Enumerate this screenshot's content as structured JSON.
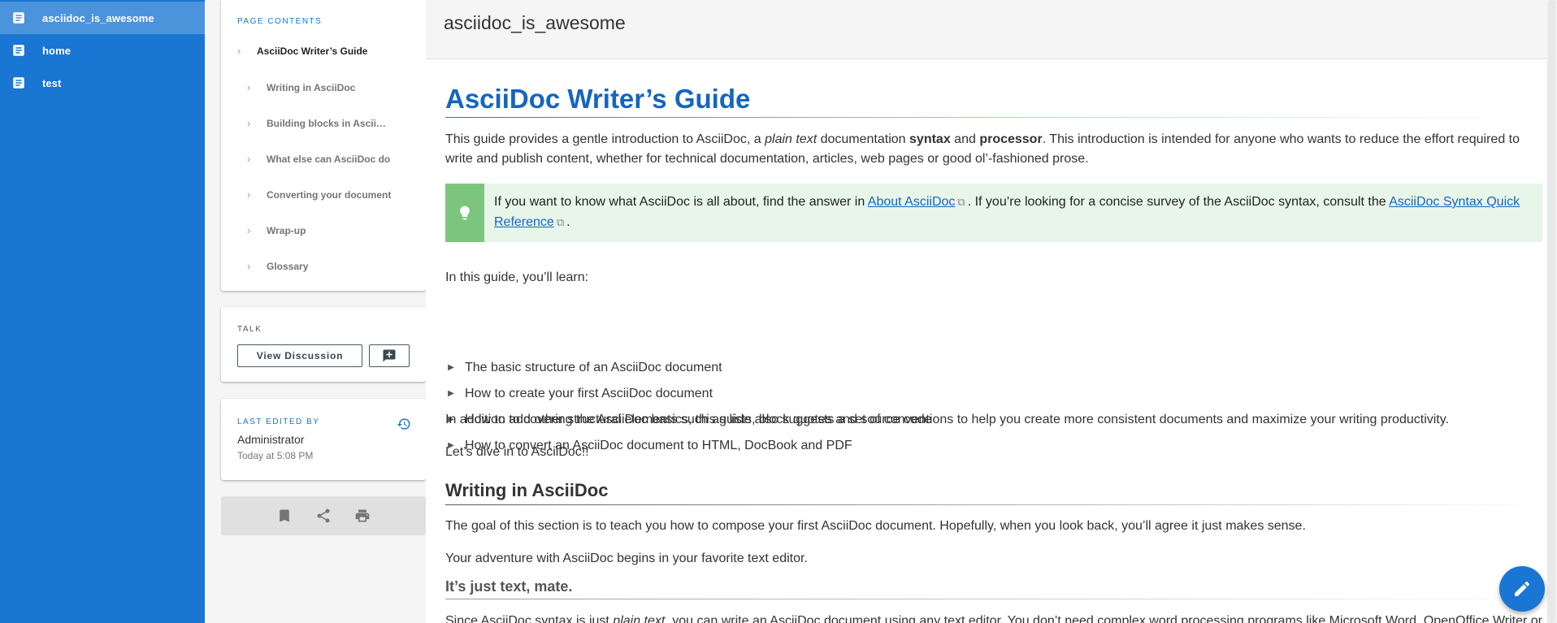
{
  "nav": {
    "items": [
      {
        "label": "asciidoc_is_awesome",
        "active": true
      },
      {
        "label": "home",
        "active": false
      },
      {
        "label": "test",
        "active": false
      }
    ]
  },
  "toc": {
    "caption": "PAGE CONTENTS",
    "title": "AsciiDoc Writer’s Guide",
    "items": [
      "Writing in AsciiDoc",
      "Building blocks in AsciiDoc",
      "What else can AsciiDoc do",
      "Converting your document",
      "Wrap-up",
      "Glossary"
    ]
  },
  "talk": {
    "caption": "TALK",
    "view_label": "View Discussion"
  },
  "edited": {
    "caption": "LAST EDITED BY",
    "who": "Administrator",
    "when": "Today at 5:08 PM"
  },
  "page": {
    "title": "asciidoc_is_awesome"
  },
  "doc": {
    "h1": "AsciiDoc Writer’s Guide",
    "intro_a": "This guide provides a gentle introduction to AsciiDoc, a ",
    "intro_em": "plain text",
    "intro_b": " documentation ",
    "intro_strong1": "syntax",
    "intro_c": " and ",
    "intro_strong2": "processor",
    "intro_d": ". This introduction is intended for anyone who wants to reduce the effort required to write and publish content, whether for technical documentation, articles, web pages or good ol’-fashioned prose.",
    "tip_a": "If you want to know what AsciiDoc is all about, find the answer in ",
    "tip_link1": "About AsciiDoc",
    "tip_b": ". If you’re looking for a concise survey of the AsciiDoc syntax, consult the ",
    "tip_link2": "AsciiDoc Syntax Quick Reference",
    "tip_c": ".",
    "learn": "In this guide, you’ll learn:",
    "bullets": [
      "The basic structure of an AsciiDoc document",
      "How to create your first AsciiDoc document",
      "How to add other structural elements such as lists, block quotes and source code",
      "How to convert an AsciiDoc document to HTML, DocBook and PDF"
    ],
    "addition": "In addition to covering the AsciiDoc basics, this guide also suggests a set of conventions to help you create more consistent documents and maximize your writing productivity.",
    "dive": "Let’s dive in to AsciiDoc!!",
    "h2": "Writing in AsciiDoc",
    "goal": "The goal of this section is to teach you how to compose your first AsciiDoc document. Hopefully, when you look back, you’ll agree it just makes sense.",
    "adventure": "Your adventure with AsciiDoc begins in your favorite text editor.",
    "h3": "It’s just text, mate.",
    "since_a": "Since AsciiDoc syntax is just ",
    "since_em": "plain text",
    "since_b": ", you can write an AsciiDoc document using any text editor. You don’t need complex word processing programs like Microsoft Word, OpenOffice Writer or"
  },
  "colors": {
    "primary": "#1976d2",
    "tip_bg": "#e8f5e9",
    "tip_bar": "#7cc57f"
  }
}
